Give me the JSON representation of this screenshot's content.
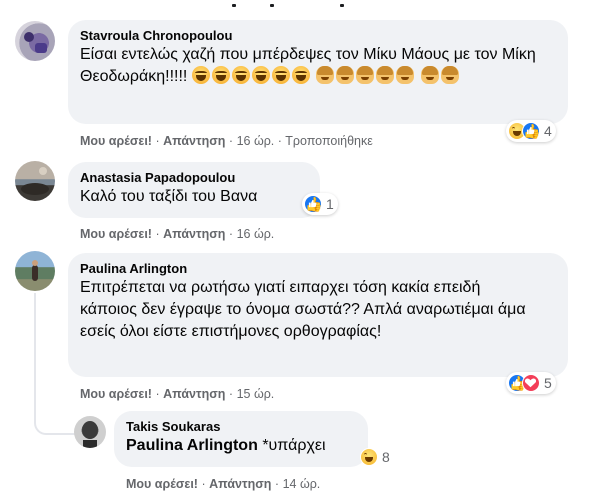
{
  "comments": [
    {
      "author": "Stavroula Chronopoulou",
      "text": "Είσαι εντελώς χαζή που μπέρδεψες τον Μίκυ Μάους με τον Μίκη Θεοδωράκη!!!!!",
      "emojis_laugh": 6,
      "emojis_woman": 7,
      "like_label": "Μου αρέσει!",
      "reply_label": "Απάντηση",
      "time": "16 ώρ.",
      "edited": "Τροποποιήθηκε",
      "reactions": [
        "haha",
        "like"
      ],
      "reaction_count": "4"
    },
    {
      "author": "Anastasia Papadopoulou",
      "text": "Καλό του ταξίδι του Βανα",
      "like_label": "Μου αρέσει!",
      "reply_label": "Απάντηση",
      "time": "16 ώρ.",
      "reactions": [
        "like"
      ],
      "reaction_count": "1"
    },
    {
      "author": "Paulina Arlington",
      "text": "Επιτρέπεται να ρωτήσω γιατί ειπαρχει τόση κακία επειδή κάποιος δεν έγραψε το όνομα σωστά?? Απλά αναρωτιέμαι άμα εσείς όλοι είστε επιστήμονες ορθογραφίας!",
      "like_label": "Μου αρέσει!",
      "reply_label": "Απάντηση",
      "time": "15 ώρ.",
      "reactions": [
        "like",
        "love"
      ],
      "reaction_count": "5"
    },
    {
      "author": "Takis Soukaras",
      "mention": "Paulina Arlington",
      "text": "*υπάρχει",
      "like_label": "Μου αρέσει!",
      "reply_label": "Απάντηση",
      "time": "14 ώρ.",
      "reactions": [
        "haha"
      ],
      "reaction_count": "8"
    }
  ],
  "separator": "·",
  "colors": {
    "bubble": "#f0f2f5",
    "meta": "#65676b",
    "like_blue": "#1877f2",
    "love_red": "#f33e58",
    "haha_yellow": "#f7b125"
  }
}
